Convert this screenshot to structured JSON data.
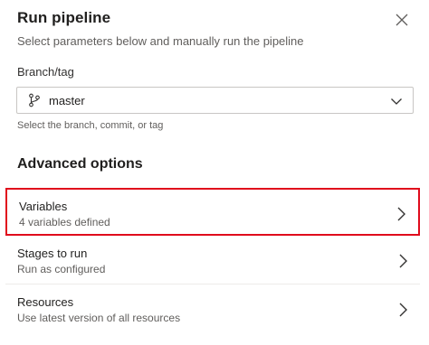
{
  "dialog": {
    "title": "Run pipeline",
    "subtitle": "Select parameters below and manually run the pipeline",
    "close_icon": "close-icon"
  },
  "branch": {
    "label": "Branch/tag",
    "value": "master",
    "icon": "branch-icon",
    "hint": "Select the branch, commit, or tag"
  },
  "advanced": {
    "title": "Advanced options",
    "options": [
      {
        "title": "Variables",
        "subtitle": "4 variables defined",
        "highlighted": true
      },
      {
        "title": "Stages to run",
        "subtitle": "Run as configured",
        "highlighted": false
      },
      {
        "title": "Resources",
        "subtitle": "Use latest version of all resources",
        "highlighted": false
      }
    ]
  },
  "colors": {
    "highlight_border": "#e00b1c",
    "text_primary": "#201f1e",
    "text_secondary": "#605e5c"
  }
}
